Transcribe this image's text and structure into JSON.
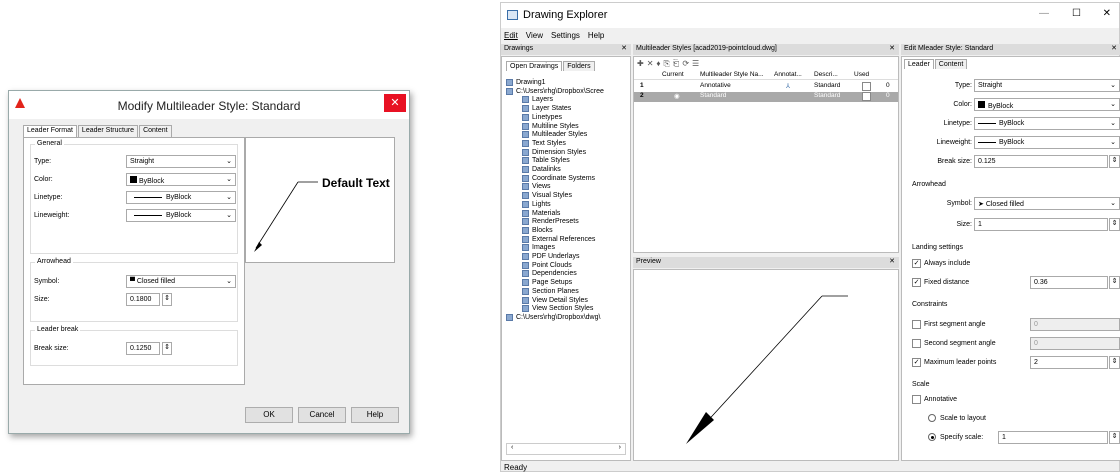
{
  "dialog": {
    "title": "Modify Multileader Style: Standard",
    "close": "✕",
    "tabs": [
      "Leader Format",
      "Leader Structure",
      "Content"
    ],
    "general": {
      "label": "General",
      "type_label": "Type:",
      "type": "Straight",
      "color_label": "Color:",
      "color": "ByBlock",
      "linetype_label": "Linetype:",
      "linetype": "ByBlock",
      "lineweight_label": "Lineweight:",
      "lineweight": "ByBlock"
    },
    "arrowhead": {
      "label": "Arrowhead",
      "symbol_label": "Symbol:",
      "symbol": "Closed filled",
      "size_label": "Size:",
      "size": "0.1800"
    },
    "leader_break": {
      "label": "Leader break",
      "break_label": "Break size:",
      "break": "0.1250"
    },
    "preview_text": "Default Text",
    "buttons": {
      "ok": "OK",
      "cancel": "Cancel",
      "help": "Help"
    }
  },
  "explorer": {
    "title": "Drawing Explorer",
    "window_controls": [
      "—",
      "☐",
      "✕"
    ],
    "menu": [
      "Edit",
      "View",
      "Settings",
      "Help"
    ],
    "drawings_header": "Drawings",
    "drawings_tabs": [
      "Open Drawings",
      "Folders"
    ],
    "tree": [
      "Drawing1",
      "C:\\Users\\rhg\\Dropbox\\Scree",
      "Layers",
      "Layer States",
      "Linetypes",
      "Multiline Styles",
      "Multileader Styles",
      "Text Styles",
      "Dimension Styles",
      "Table Styles",
      "Datalinks",
      "Coordinate Systems",
      "Views",
      "Visual Styles",
      "Lights",
      "Materials",
      "RenderPresets",
      "Blocks",
      "External References",
      "Images",
      "PDF Underlays",
      "Point Clouds",
      "Dependencies",
      "Page Setups",
      "Section Planes",
      "View Detail Styles",
      "View Section Styles",
      "C:\\Users\\rhg\\Dropbox\\dwg\\"
    ],
    "styles_header": "Multileader Styles [acad2019-pointcloud.dwg]",
    "table_headers": [
      "Current",
      "Multileader Style Na...",
      "Annotat...",
      "Descri...",
      "Used"
    ],
    "rows": [
      {
        "num": "1",
        "name": "Annotative",
        "desc": "Standard",
        "used": "0"
      },
      {
        "num": "2",
        "name": "Standard",
        "desc": "Standard",
        "used": "0"
      }
    ],
    "preview_header": "Preview",
    "edit_header": "Edit Mleader Style: Standard",
    "edit_tabs": [
      "Leader",
      "Content"
    ],
    "edit": {
      "type_label": "Type:",
      "type": "Straight",
      "color_label": "Color:",
      "color": "ByBlock",
      "linetype_label": "Linetype:",
      "linetype": "ByBlock",
      "lineweight_label": "Lineweight:",
      "lineweight": "ByBlock",
      "break_label": "Break size:",
      "break": "0.125",
      "arrowhead_label": "Arrowhead",
      "symbol_label": "Symbol:",
      "symbol": "Closed filled",
      "size_label": "Size:",
      "size": "1",
      "landing_label": "Landing settings",
      "always_include": "Always include",
      "fixed_distance": "Fixed distance",
      "fixed_value": "0.36",
      "constraints_label": "Constraints",
      "first_seg": "First segment angle",
      "first_val": "0",
      "second_seg": "Second segment angle",
      "second_val": "0",
      "max_points": "Maximum leader points",
      "max_val": "2",
      "scale_label": "Scale",
      "annotative": "Annotative",
      "scale_layout": "Scale to layout",
      "specify_scale": "Specify scale:",
      "scale_val": "1"
    },
    "status_text": "Ready"
  }
}
